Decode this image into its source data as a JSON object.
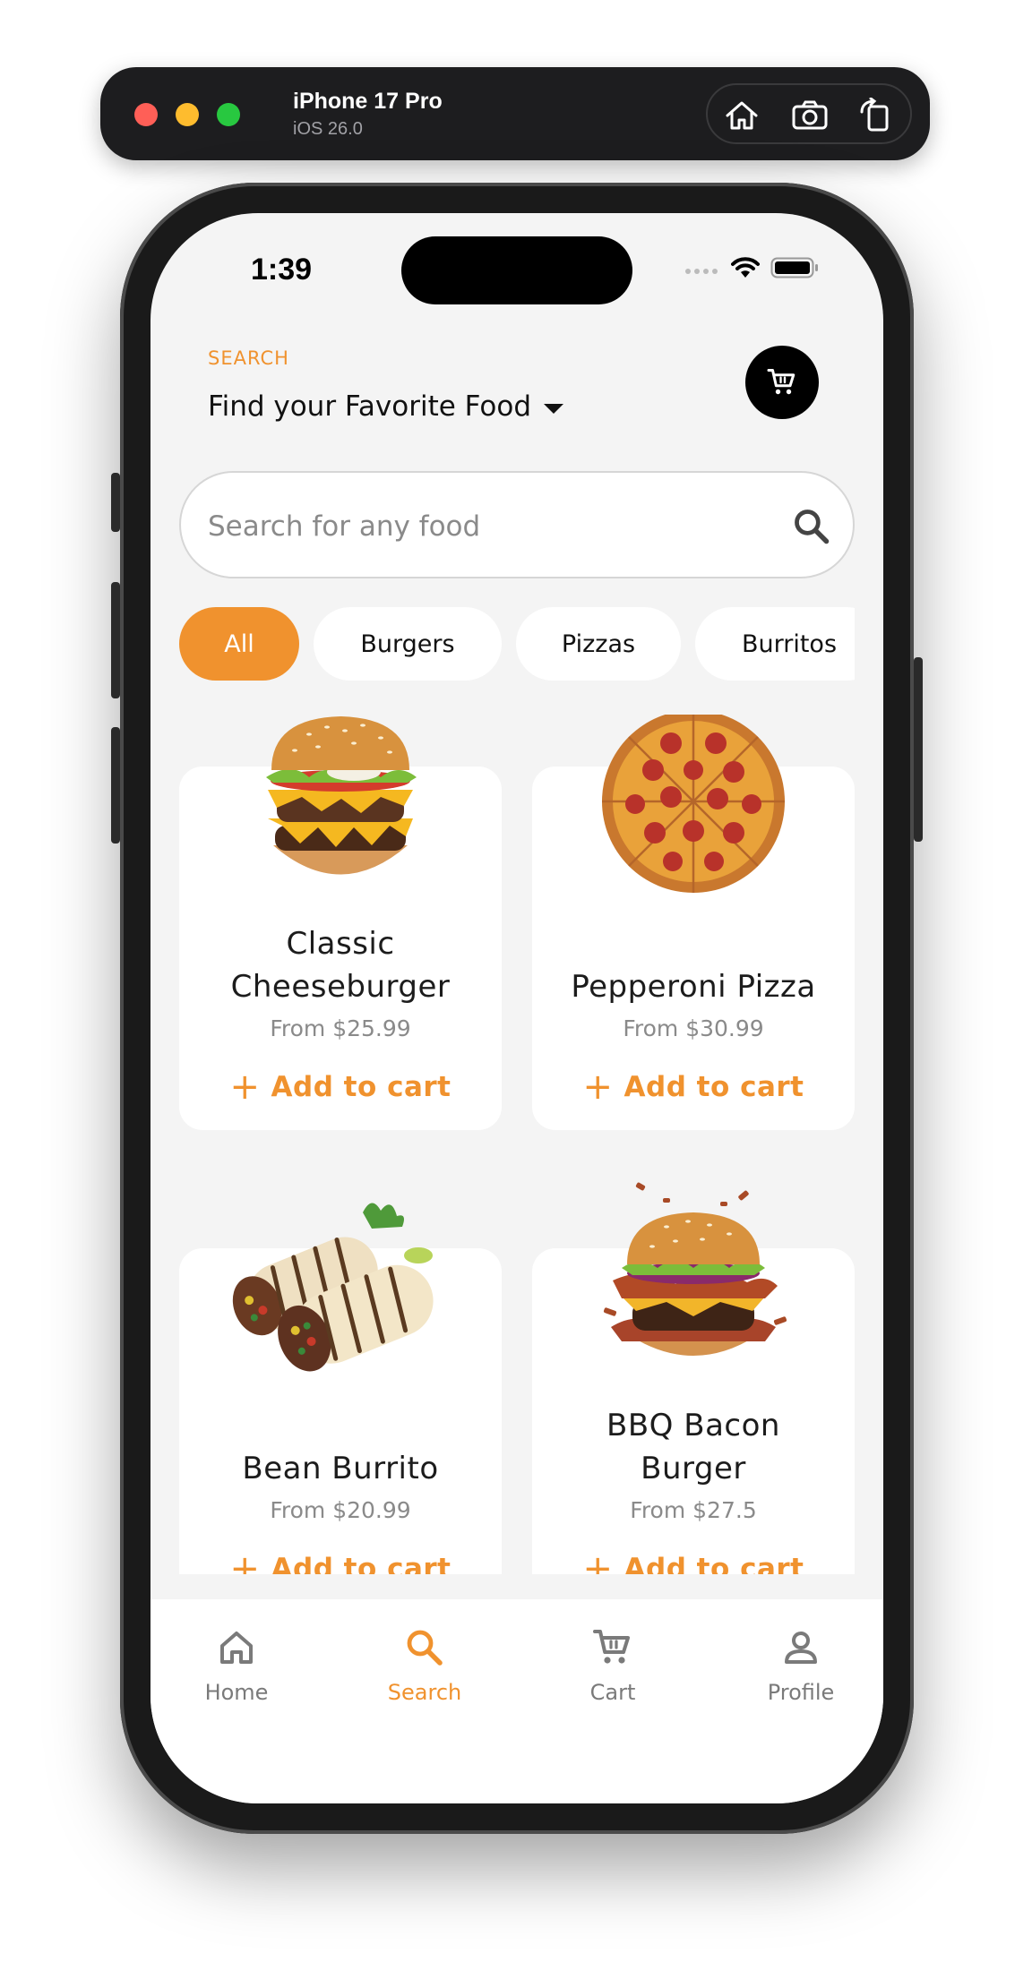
{
  "simulator": {
    "device_name": "iPhone 17 Pro",
    "os_version": "iOS 26.0",
    "tools": [
      "home-icon",
      "screenshot-icon",
      "rotate-icon"
    ]
  },
  "status_bar": {
    "time": "1:39"
  },
  "header": {
    "eyebrow": "SEARCH",
    "title": "Find your Favorite Food"
  },
  "search": {
    "placeholder": "Search for any food"
  },
  "categories": [
    "All",
    "Burgers",
    "Pizzas",
    "Burritos"
  ],
  "selected_category": "All",
  "products": [
    {
      "name": "Classic Cheeseburger",
      "price": "From $25.99",
      "action": "Add to cart",
      "image": "cheeseburger-image"
    },
    {
      "name": "Pepperoni Pizza",
      "price": "From $30.99",
      "action": "Add to cart",
      "image": "pizza-image"
    },
    {
      "name": "Bean Burrito",
      "price": "From $20.99",
      "action": "Add to cart",
      "image": "burrito-image"
    },
    {
      "name": "BBQ Bacon Burger",
      "price": "From $27.5",
      "action": "Add to cart",
      "image": "bbq-burger-image"
    }
  ],
  "tabs": [
    {
      "label": "Home",
      "icon": "home-icon"
    },
    {
      "label": "Search",
      "icon": "search-icon"
    },
    {
      "label": "Cart",
      "icon": "cart-icon"
    },
    {
      "label": "Profile",
      "icon": "profile-icon"
    }
  ],
  "active_tab": "Search",
  "colors": {
    "accent": "#f0922e",
    "background": "#f4f4f4",
    "card": "#ffffff",
    "fab": "#000000"
  }
}
